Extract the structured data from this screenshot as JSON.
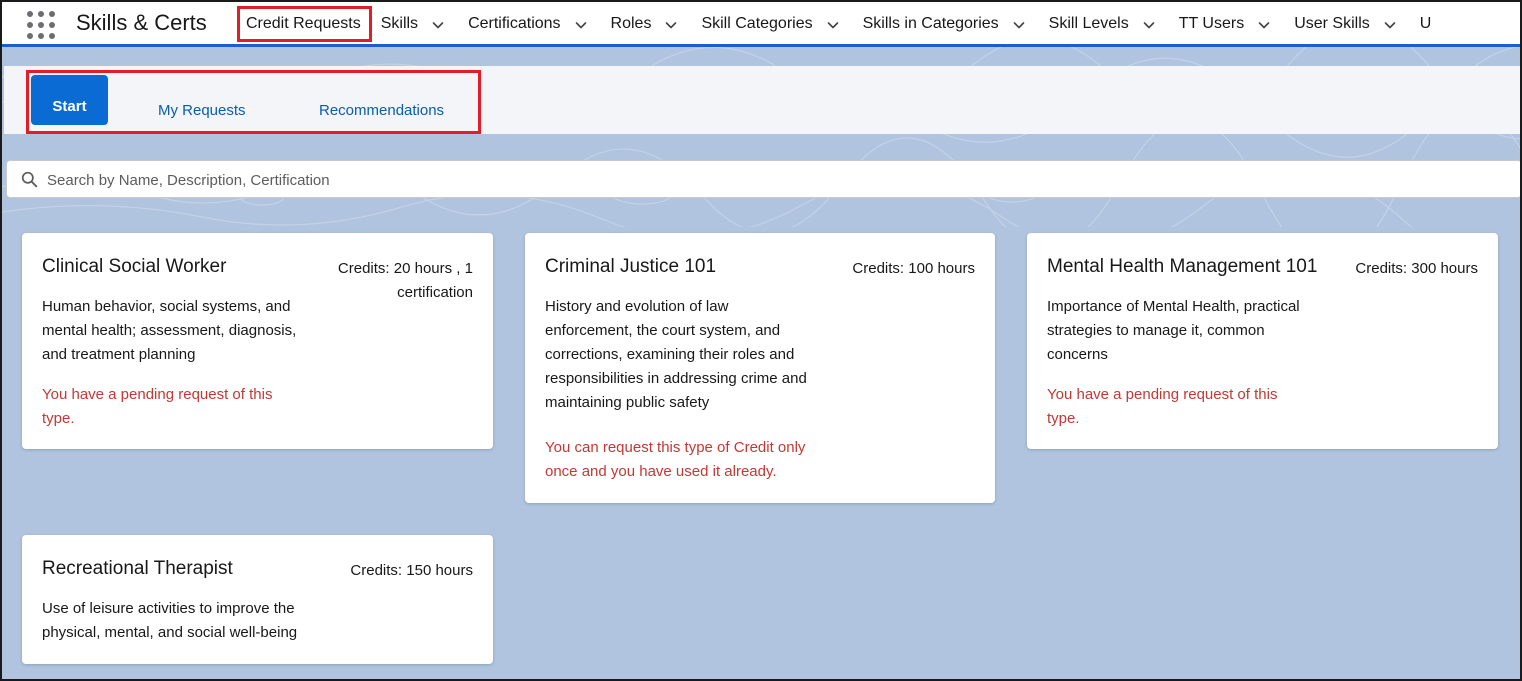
{
  "app": {
    "title": "Skills & Certs"
  },
  "nav": [
    {
      "label": "Credit Requests",
      "has_menu": false,
      "active": true
    },
    {
      "label": "Skills",
      "has_menu": true
    },
    {
      "label": "Certifications",
      "has_menu": true
    },
    {
      "label": "Roles",
      "has_menu": true
    },
    {
      "label": "Skill Categories",
      "has_menu": true
    },
    {
      "label": "Skills in Categories",
      "has_menu": true
    },
    {
      "label": "Skill Levels",
      "has_menu": true
    },
    {
      "label": "TT Users",
      "has_menu": true
    },
    {
      "label": "User Skills",
      "has_menu": true
    },
    {
      "label": "U",
      "has_menu": false
    }
  ],
  "tabs": {
    "start": "Start",
    "my_requests": "My Requests",
    "recommendations": "Recommendations"
  },
  "search": {
    "placeholder": "Search by Name, Description, Certification",
    "value": ""
  },
  "cards": [
    {
      "title": "Clinical Social Worker",
      "credits": [
        "Credits: 20 hours , 1",
        "certification"
      ],
      "description": [
        "Human behavior, social systems, and",
        "mental health; assessment, diagnosis,",
        "and treatment planning"
      ],
      "warning": [
        "You have a pending request of this",
        "type."
      ]
    },
    {
      "title": "Criminal Justice 101",
      "credits": [
        "Credits: 100 hours"
      ],
      "description": [
        "History and evolution of law",
        "enforcement, the court system, and",
        "corrections, examining their roles and",
        "responsibilities in addressing crime and",
        "maintaining public safety"
      ],
      "warning": [
        "You can request this type of Credit only",
        "once and you have used it already."
      ]
    },
    {
      "title": "Mental Health Management 101",
      "credits": [
        "Credits: 300 hours"
      ],
      "description": [
        "Importance of Mental Health, practical",
        "strategies to manage it, common",
        "concerns"
      ],
      "warning": [
        "You have a pending request of this",
        "type."
      ]
    },
    {
      "title": "Recreational Therapist",
      "credits": [
        "Credits: 150 hours"
      ],
      "description": [
        "Use of leisure activities to improve the",
        "physical, mental, and social well-being"
      ],
      "warning": []
    }
  ],
  "colors": {
    "accent": "#0b6bd4",
    "nav_border": "#1b5fcc",
    "warning": "#c23934",
    "highlight": "#e11d2a",
    "background": "#b0c4df"
  }
}
